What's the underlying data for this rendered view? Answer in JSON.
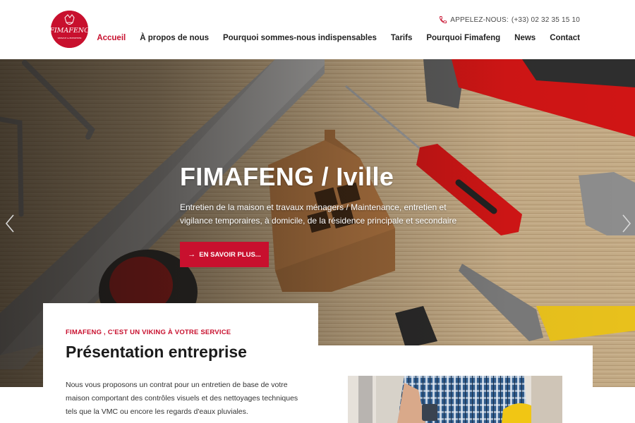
{
  "header": {
    "logo": {
      "text": "FIMAFENG",
      "tagline": "SERVICE & ENTRETIEN",
      "icon": "viking-logo-icon"
    },
    "phone": {
      "icon": "phone-icon",
      "label": "APPELEZ-NOUS:",
      "number": "(+33) 02 32 35 15 10"
    },
    "nav": [
      {
        "label": "Accueil",
        "active": true
      },
      {
        "label": "À propos de nous",
        "active": false
      },
      {
        "label": "Pourquoi sommes-nous indispensables",
        "active": false
      },
      {
        "label": "Tarifs",
        "active": false
      },
      {
        "label": "Pourquoi Fimafeng",
        "active": false
      },
      {
        "label": "News",
        "active": false
      },
      {
        "label": "Contact",
        "active": false
      }
    ]
  },
  "hero": {
    "title": "FIMAFENG / Iville",
    "subtitle": "Entretien de la maison et travaux ménagers / Maintenance, entretien et vigilance temporaires, à domicile, de la résidence principale et secondaire",
    "button": {
      "icon": "arrow-right-icon",
      "label": "EN SAVOIR PLUS..."
    },
    "prev_icon": "chevron-left-icon",
    "next_icon": "chevron-right-icon"
  },
  "about": {
    "kicker": "FIMAFENG , C'EST UN VIKING À VOTRE SERVICE",
    "title": "Présentation entreprise",
    "text": "Nous vous proposons un contrat pour un entretien de base de votre maison comportant des contrôles visuels et des nettoyages techniques tels que la VMC ou encore les regards d'eaux pluviales."
  },
  "colors": {
    "brand": "#c8102e",
    "text": "#1b1b1b"
  }
}
